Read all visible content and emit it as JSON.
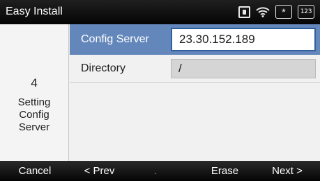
{
  "titlebar": {
    "title": "Easy Install",
    "icons": [
      "phone-line-icon",
      "wifi-icon",
      "star-icon",
      "numeric-input-icon"
    ],
    "star_glyph": "*",
    "numeric_mode": "123"
  },
  "stepper": {
    "step_number": "4",
    "step_label_lines": [
      "Setting",
      "Config",
      "Server"
    ]
  },
  "form": {
    "config_server": {
      "label": "Config Server",
      "value": "23.30.152.189",
      "selected": true
    },
    "directory": {
      "label": "Directory",
      "value": "/"
    }
  },
  "softkeys": {
    "cancel": "Cancel",
    "prev": "< Prev",
    "dot": ".",
    "erase": "Erase",
    "next": "Next >"
  },
  "colors": {
    "selected_row": "#6387bb",
    "selected_input_border": "#2f5e9c",
    "bar_background": "#0a0a0a"
  }
}
